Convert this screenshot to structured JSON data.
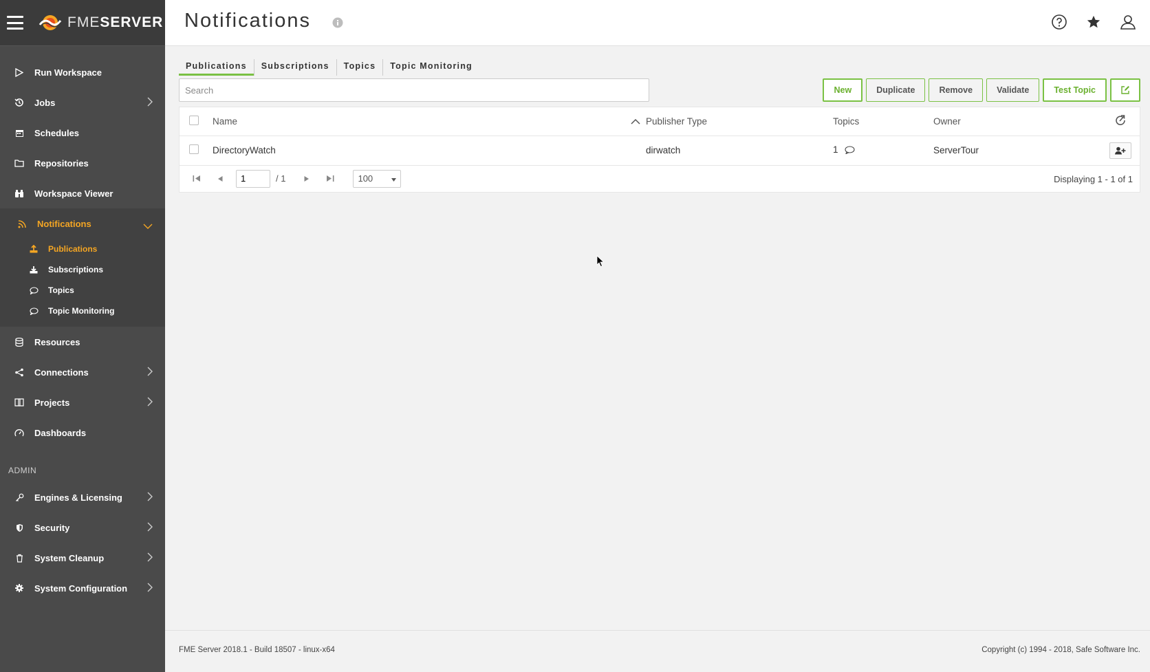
{
  "brand": {
    "prefix": "FME",
    "suffix": "SERVER"
  },
  "sidebar": {
    "items": [
      {
        "label": "Run Workspace",
        "icon": "play-icon"
      },
      {
        "label": "Jobs",
        "icon": "history-icon"
      },
      {
        "label": "Schedules",
        "icon": "calendar-icon"
      },
      {
        "label": "Repositories",
        "icon": "folder-icon"
      },
      {
        "label": "Workspace Viewer",
        "icon": "binoculars-icon"
      },
      {
        "label": "Notifications",
        "icon": "rss-icon"
      }
    ],
    "notifications_sub": [
      {
        "label": "Publications",
        "icon": "upload-icon"
      },
      {
        "label": "Subscriptions",
        "icon": "download-icon"
      },
      {
        "label": "Topics",
        "icon": "comment-icon"
      },
      {
        "label": "Topic Monitoring",
        "icon": "comment-icon"
      }
    ],
    "items2": [
      {
        "label": "Resources",
        "icon": "database-icon"
      },
      {
        "label": "Connections",
        "icon": "share-icon"
      },
      {
        "label": "Projects",
        "icon": "book-icon"
      },
      {
        "label": "Dashboards",
        "icon": "dashboard-icon"
      }
    ],
    "admin_label": "ADMIN",
    "admin_items": [
      {
        "label": "Engines & Licensing",
        "icon": "key-icon"
      },
      {
        "label": "Security",
        "icon": "shield-icon"
      },
      {
        "label": "System Cleanup",
        "icon": "trash-icon"
      },
      {
        "label": "System Configuration",
        "icon": "gear-icon"
      }
    ]
  },
  "header": {
    "title": "Notifications"
  },
  "tabs": [
    "Publications",
    "Subscriptions",
    "Topics",
    "Topic Monitoring"
  ],
  "search": {
    "placeholder": "Search",
    "value": ""
  },
  "actions": {
    "new": "New",
    "duplicate": "Duplicate",
    "remove": "Remove",
    "validate": "Validate",
    "test_topic": "Test Topic"
  },
  "table": {
    "columns": [
      "Name",
      "Publisher Type",
      "Topics",
      "Owner"
    ],
    "rows": [
      {
        "name": "DirectoryWatch",
        "type": "dirwatch",
        "topics": "1",
        "owner": "ServerTour"
      }
    ]
  },
  "pager": {
    "page": "1",
    "total": "/ 1",
    "per_page": "100",
    "displaying": "Displaying 1 - 1 of 1"
  },
  "footer": {
    "left": "FME Server 2018.1 - Build 18507 - linux-x64",
    "right": "Copyright (c) 1994 - 2018, Safe Software Inc."
  },
  "colors": {
    "sidebar_bg": "#4a4a4a",
    "accent_orange": "#f5a623",
    "accent_green": "#7ac143"
  }
}
